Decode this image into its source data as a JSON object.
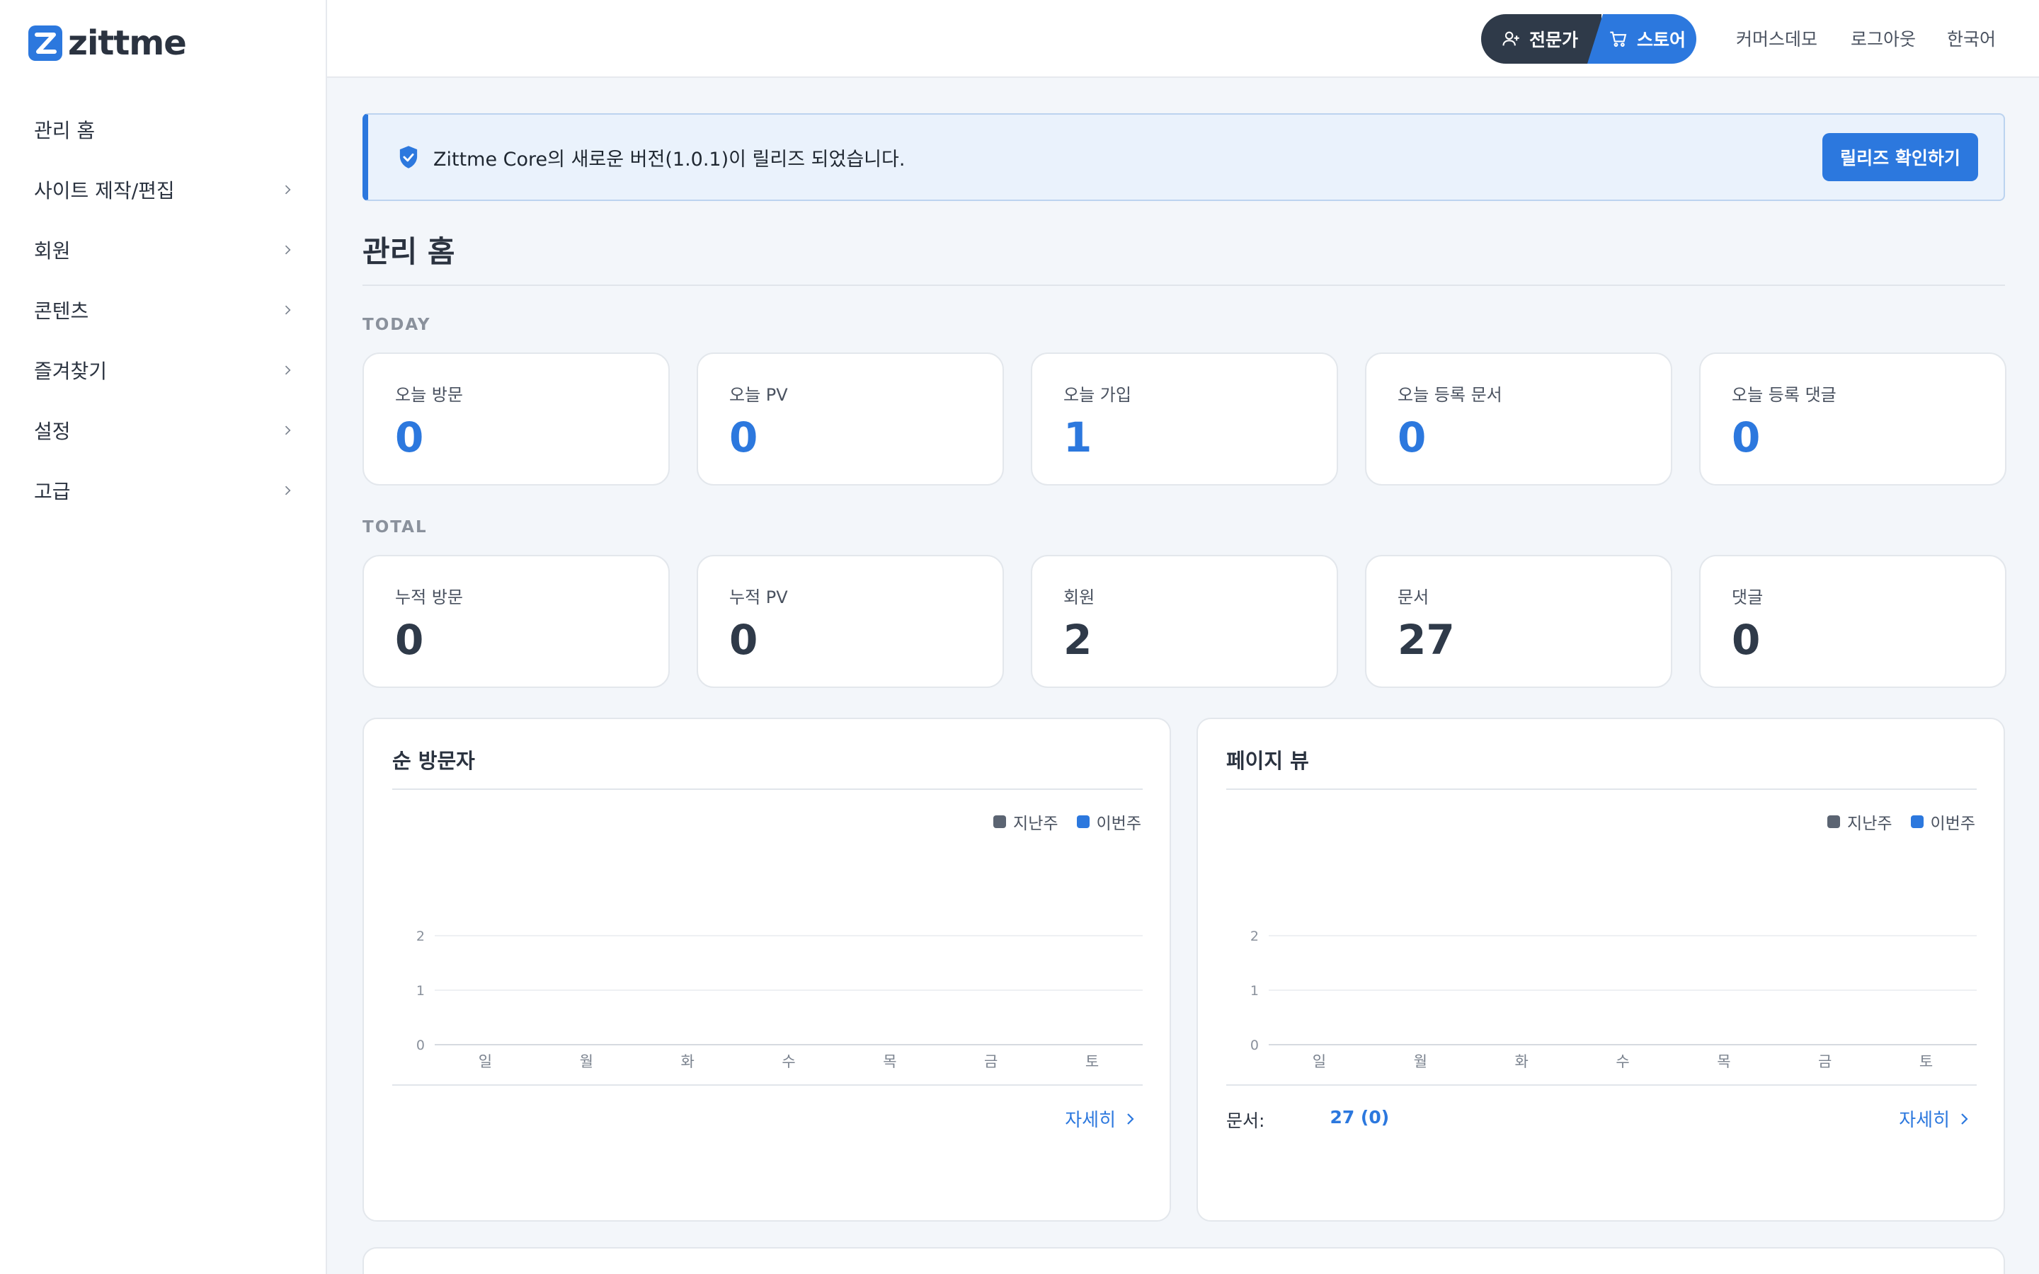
{
  "brand": {
    "name": "zittme",
    "color": "#2c78de"
  },
  "sidebar": {
    "items": [
      {
        "label": "관리 홈",
        "has_children": false
      },
      {
        "label": "사이트 제작/편집",
        "has_children": true
      },
      {
        "label": "회원",
        "has_children": true
      },
      {
        "label": "콘텐츠",
        "has_children": true
      },
      {
        "label": "즐겨찾기",
        "has_children": true
      },
      {
        "label": "설정",
        "has_children": true
      },
      {
        "label": "고급",
        "has_children": true
      }
    ]
  },
  "topbar": {
    "expert_label": "전문가",
    "store_label": "스토어",
    "links": [
      "커머스데모",
      "로그아웃",
      "한국어"
    ]
  },
  "notice": {
    "text": "Zittme Core의 새로운 버전(1.0.1)이 릴리즈 되었습니다.",
    "button": "릴리즈 확인하기"
  },
  "page": {
    "title": "관리 홈"
  },
  "today": {
    "section": "TODAY",
    "cards": [
      {
        "label": "오늘 방문",
        "value": "0"
      },
      {
        "label": "오늘 PV",
        "value": "0"
      },
      {
        "label": "오늘 가입",
        "value": "1"
      },
      {
        "label": "오늘 등록 문서",
        "value": "0"
      },
      {
        "label": "오늘 등록 댓글",
        "value": "0"
      }
    ]
  },
  "total": {
    "section": "TOTAL",
    "cards": [
      {
        "label": "누적 방문",
        "value": "0"
      },
      {
        "label": "누적 PV",
        "value": "0"
      },
      {
        "label": "회원",
        "value": "2"
      },
      {
        "label": "문서",
        "value": "27"
      },
      {
        "label": "댓글",
        "value": "0"
      }
    ]
  },
  "panels": {
    "visitors": {
      "title": "순 방문자",
      "more": "자세히"
    },
    "pageviews": {
      "title": "페이지 뷰",
      "more": "자세히",
      "footer_label": "문서:",
      "footer_value": "27 (0)"
    }
  },
  "chart_data": [
    {
      "type": "bar",
      "title": "순 방문자",
      "categories": [
        "일",
        "월",
        "화",
        "수",
        "목",
        "금",
        "토"
      ],
      "series": [
        {
          "name": "지난주",
          "color": "#5b6472",
          "values": [
            0,
            0,
            0,
            0,
            0,
            0,
            0
          ]
        },
        {
          "name": "이번주",
          "color": "#2c78de",
          "values": [
            0,
            0,
            0,
            0,
            0,
            0,
            0
          ]
        }
      ],
      "yticks": [
        "0",
        "1",
        "2"
      ],
      "ylim": [
        0,
        2
      ],
      "grid": true,
      "legend": "top-right"
    },
    {
      "type": "bar",
      "title": "페이지 뷰",
      "categories": [
        "일",
        "월",
        "화",
        "수",
        "목",
        "금",
        "토"
      ],
      "series": [
        {
          "name": "지난주",
          "color": "#5b6472",
          "values": [
            0,
            0,
            0,
            0,
            0,
            0,
            0
          ]
        },
        {
          "name": "이번주",
          "color": "#2c78de",
          "values": [
            0,
            0,
            0,
            0,
            0,
            0,
            0
          ]
        }
      ],
      "yticks": [
        "0",
        "1",
        "2"
      ],
      "ylim": [
        0,
        2
      ],
      "grid": true,
      "legend": "top-right"
    }
  ]
}
